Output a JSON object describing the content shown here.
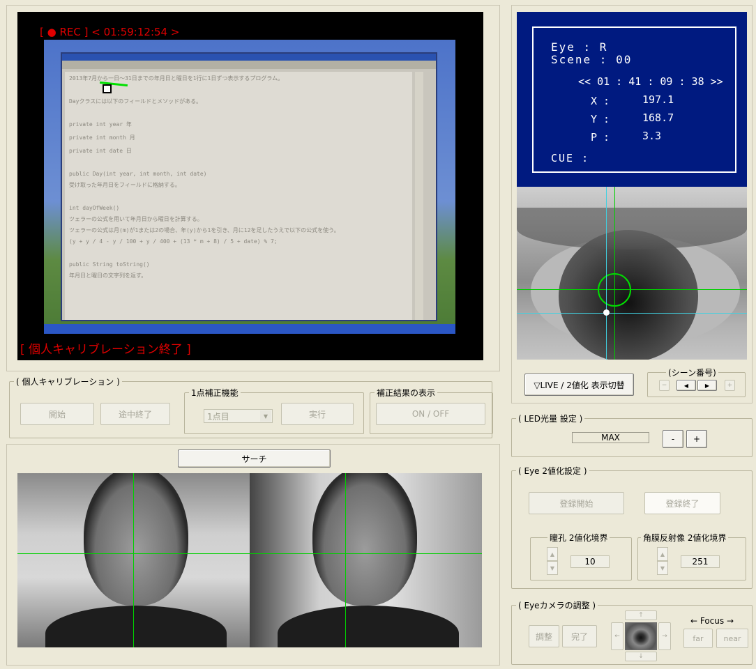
{
  "scene": {
    "rec_label": "[ ● REC ] < 01:59:12:54 >",
    "status": "[ 個人キャリブレーション終了 ]",
    "screen_lines": [
      "2013年7月から一日〜31日までの年月日と曜日を1行に1日ずつ表示するプログラム。",
      "Dayクラスには以下のフィールドとメソッドがある。",
      "private int year 年",
      "private int month 月",
      "private int date 日",
      "public Day(int year, int month, int date)",
      "受け取った年月日をフィールドに格納する。",
      "int dayOfWeek()",
      "ツェラーの公式を用いて年月日から曜日を計算する。",
      "ツェラーの公式は月(m)が1または2の場合、年(y)から1を引き、月に12を足したうえで以下の公式を使う。",
      "(y + y / 4 - y / 100 + y / 400 + (13 * m + 8) / 5 + date) % 7;",
      "public String toString()",
      "年月日と曜日の文字列を返す。"
    ]
  },
  "calibration": {
    "title": "( 個人キャリブレーション )",
    "start": "開始",
    "abort": "途中終了",
    "one_point_title": "1点補正機能",
    "one_point_select": "1点目",
    "execute": "実行",
    "result_title": "補正結果の表示",
    "onoff": "ON / OFF"
  },
  "search": {
    "label": "サーチ"
  },
  "eye_info": {
    "eye_label": "Eye : R",
    "scene_label": "Scene : 00",
    "timecode": "<< 01 : 41 : 09 : 38 >>",
    "x_label": "X :",
    "x_value": "197.1",
    "y_label": "Y :",
    "y_value": "168.7",
    "p_label": "P :",
    "p_value": "3.3",
    "cue_label": "CUE :"
  },
  "view_toggle": "▽LIVE / 2値化 表示切替",
  "scene_number": {
    "title": "(シーン番号)",
    "minus": "−",
    "prev": "◀",
    "next": "▶",
    "plus": "+"
  },
  "led": {
    "title": "( LED光量 設定 )",
    "value": "MAX",
    "minus": "-",
    "plus": "+"
  },
  "binarize": {
    "title": "( Eye 2値化設定 )",
    "start": "登録開始",
    "end": "登録終了",
    "pupil_title": "瞳孔 2値化境界",
    "pupil_value": "10",
    "cornea_title": "角膜反射像 2値化境界",
    "cornea_value": "251"
  },
  "camera": {
    "title": "( Eyeカメラの調整 )",
    "adjust": "調整",
    "done": "完了",
    "up": "↑",
    "down": "↓",
    "left": "←",
    "right": "→",
    "focus_label": "← Focus →",
    "far": "far",
    "near": "near"
  }
}
